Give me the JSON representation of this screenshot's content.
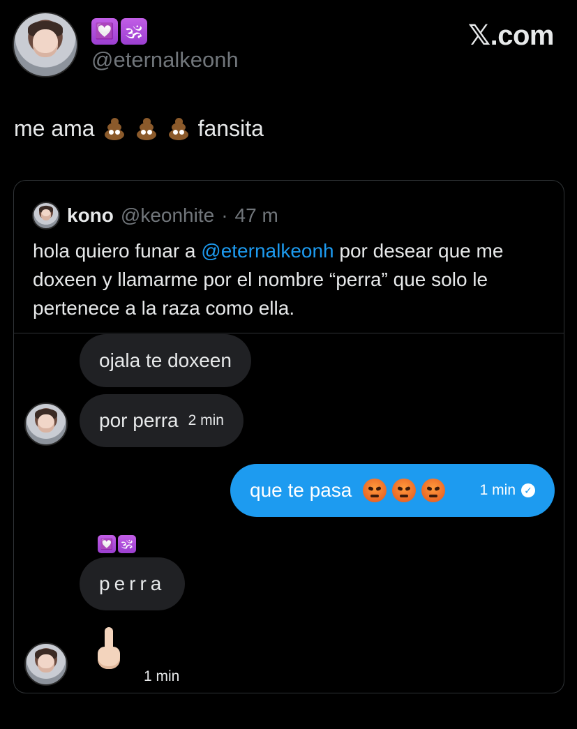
{
  "author": {
    "badges": [
      "💟",
      "🕉"
    ],
    "handle": "@eternalkeonh"
  },
  "watermark": "𝕏.com",
  "tweet": {
    "text_start": "me ama",
    "text_end": "fansita"
  },
  "quote": {
    "name": "kono",
    "handle": "@keonhite",
    "separator": "·",
    "time": "47 m",
    "body_before": "hola quiero funar a ",
    "mention": "@eternalkeonh",
    "body_after": " por desear que me doxeen y llamarme por el nombre “perra” que solo le pertenece a la raza como ella."
  },
  "chat": {
    "msg1": "ojala te doxeen",
    "msg2": "por perra",
    "msg2_time": "2 min",
    "sent_text": "que te pasa",
    "sent_time": "1 min",
    "badges": [
      "💟",
      "🕉"
    ],
    "msg3": "perra",
    "last_time": "1 min"
  },
  "colors": {
    "background": "#000000",
    "accent": "#1d9bf0",
    "bubble": "#202124",
    "muted": "#71767b"
  }
}
